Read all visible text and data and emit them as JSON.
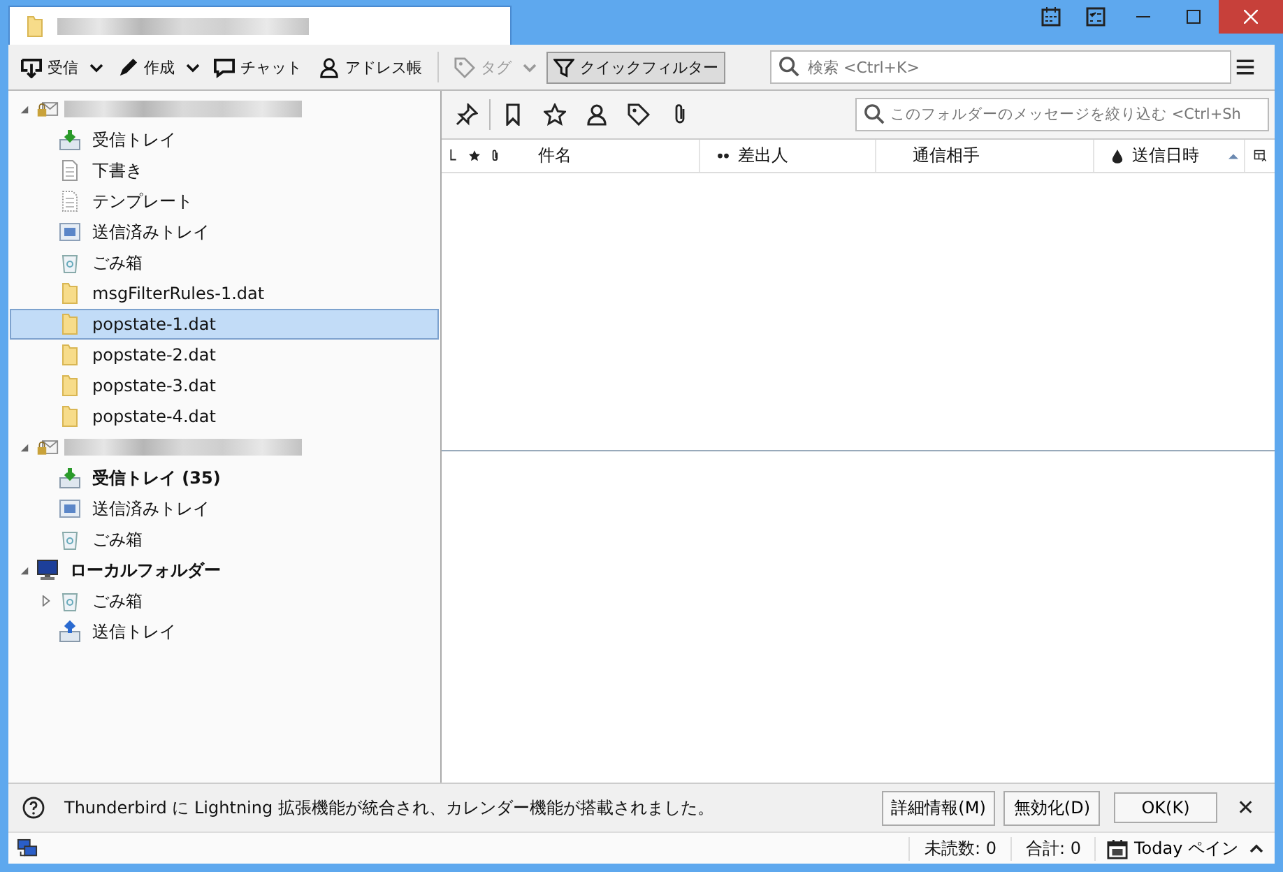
{
  "toolbar": {
    "buttons": [
      {
        "label": "受信",
        "kind": "get",
        "menu": true,
        "disabled": false
      },
      {
        "label": "作成",
        "kind": "write",
        "menu": true,
        "disabled": false
      },
      {
        "label": "チャット",
        "kind": "chat",
        "menu": false,
        "disabled": false
      },
      {
        "label": "アドレス帳",
        "kind": "address",
        "menu": false,
        "disabled": false
      },
      {
        "label": "タグ",
        "kind": "tag",
        "menu": true,
        "disabled": true
      },
      {
        "label": "クイックフィルター",
        "kind": "filter",
        "menu": false,
        "disabled": false,
        "selected": true
      }
    ],
    "search": {
      "placeholder": "検索 <Ctrl+K>"
    }
  },
  "folder_tree": [
    {
      "kind": "account",
      "expanded": true,
      "selected": false,
      "children": [
        {
          "label": "受信トレイ",
          "kind": "inbox",
          "selected": false,
          "bold": false
        },
        {
          "label": "下書き",
          "kind": "drafts",
          "selected": false,
          "bold": false
        },
        {
          "label": "テンプレート",
          "kind": "templates",
          "selected": false,
          "bold": false
        },
        {
          "label": "送信済みトレイ",
          "kind": "sent",
          "selected": false,
          "bold": false
        },
        {
          "label": "ごみ箱",
          "kind": "trash",
          "selected": false,
          "bold": false
        },
        {
          "label": "msgFilterRules-1.dat",
          "kind": "folder",
          "selected": false,
          "bold": false
        },
        {
          "label": "popstate-1.dat",
          "kind": "folder",
          "selected": true,
          "bold": false
        },
        {
          "label": "popstate-2.dat",
          "kind": "folder",
          "selected": false,
          "bold": false
        },
        {
          "label": "popstate-3.dat",
          "kind": "folder",
          "selected": false,
          "bold": false
        },
        {
          "label": "popstate-4.dat",
          "kind": "folder",
          "selected": false,
          "bold": false
        }
      ]
    },
    {
      "kind": "account",
      "expanded": true,
      "selected": false,
      "children": [
        {
          "label": "受信トレイ (35)",
          "kind": "inbox",
          "selected": false,
          "bold": true
        },
        {
          "label": "送信済みトレイ",
          "kind": "sent",
          "selected": false,
          "bold": false
        },
        {
          "label": "ごみ箱",
          "kind": "trash",
          "selected": false,
          "bold": false
        }
      ]
    },
    {
      "label": "ローカルフォルダー",
      "kind": "local",
      "expanded": true,
      "selected": false,
      "bold": true,
      "children": [
        {
          "label": "ごみ箱",
          "kind": "trash",
          "selected": false,
          "bold": false,
          "expanded": false,
          "has_children": true
        },
        {
          "label": "送信トレイ",
          "kind": "outbox",
          "selected": false,
          "bold": false
        }
      ]
    }
  ],
  "quick_filter": {
    "placeholder": "このフォルダーのメッセージを絞り込む <Ctrl+Sh"
  },
  "columns": [
    {
      "label": "件名"
    },
    {
      "label": "差出人"
    },
    {
      "label": "通信相手"
    },
    {
      "label": "送信日時",
      "sorted": true
    }
  ],
  "notification": {
    "message": "Thunderbird に Lightning 拡張機能が統合され、カレンダー機能が搭載されました。",
    "buttons": [
      "詳細情報(M)",
      "無効化(D)",
      "OK(K)"
    ],
    "close": "✕"
  },
  "status_bar": {
    "unread": "未読数: 0",
    "total": "合計: 0",
    "today_pane": "Today ペイン"
  }
}
